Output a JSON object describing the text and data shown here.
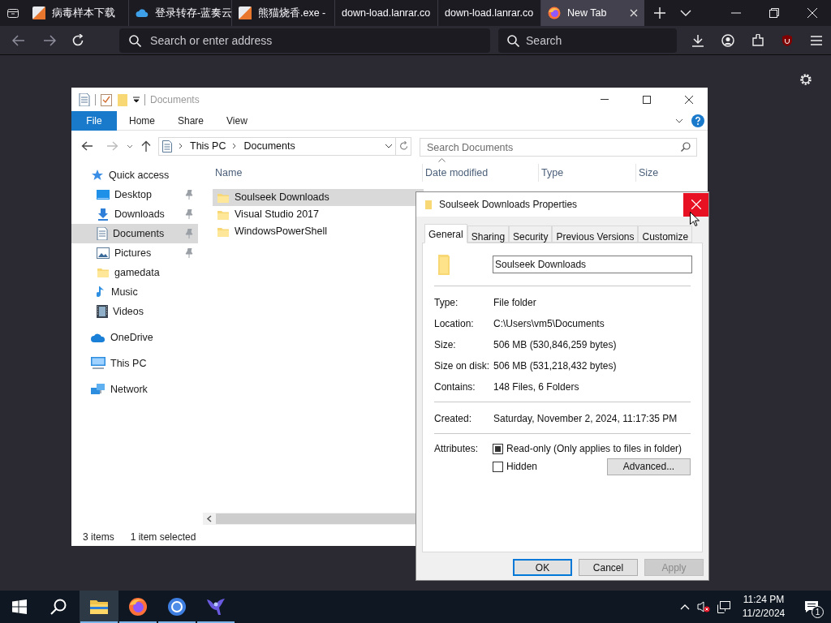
{
  "browser": {
    "tabs": [
      {
        "title": "病毒样本下载",
        "kind": "site",
        "selected": false
      },
      {
        "title": "登录转存-蓝奏云",
        "kind": "cloud",
        "selected": false
      },
      {
        "title": "熊猫烧香.exe -",
        "kind": "site",
        "selected": false
      },
      {
        "title": "down-load.lanrar.co",
        "kind": "plain",
        "selected": false
      },
      {
        "title": "down-load.lanrar.co",
        "kind": "plain",
        "selected": false
      },
      {
        "title": "New Tab",
        "kind": "firefox",
        "selected": true
      }
    ],
    "address": {
      "placeholder": "Search or enter address"
    },
    "search": {
      "placeholder": "Search"
    }
  },
  "explorer": {
    "title": "Documents",
    "ribbon_tabs": [
      {
        "label": "File",
        "selected": true
      },
      {
        "label": "Home",
        "selected": false
      },
      {
        "label": "Share",
        "selected": false
      },
      {
        "label": "View",
        "selected": false
      }
    ],
    "path": [
      "This PC",
      "Documents"
    ],
    "search": {
      "placeholder": "Search Documents"
    },
    "columns": [
      "Name",
      "Date modified",
      "Type",
      "Size"
    ],
    "nav": [
      {
        "label": "Quick access",
        "kind": "star",
        "selected": false,
        "children": [
          {
            "label": "Desktop",
            "kind": "desktop",
            "pinned": true,
            "selected": false
          },
          {
            "label": "Downloads",
            "kind": "download",
            "pinned": true,
            "selected": false
          },
          {
            "label": "Documents",
            "kind": "document",
            "pinned": true,
            "selected": true
          },
          {
            "label": "Pictures",
            "kind": "picture",
            "pinned": true,
            "selected": false
          },
          {
            "label": "gamedata",
            "kind": "folder",
            "pinned": false,
            "selected": false
          },
          {
            "label": "Music",
            "kind": "music",
            "pinned": false,
            "selected": false
          },
          {
            "label": "Videos",
            "kind": "video",
            "pinned": false,
            "selected": false
          }
        ]
      },
      {
        "label": "OneDrive",
        "kind": "cloud",
        "selected": false
      },
      {
        "label": "This PC",
        "kind": "pc",
        "selected": false
      },
      {
        "label": "Network",
        "kind": "network",
        "selected": false
      }
    ],
    "files": [
      {
        "name": "Soulseek Downloads",
        "selected": true
      },
      {
        "name": "Visual Studio 2017",
        "selected": false
      },
      {
        "name": "WindowsPowerShell",
        "selected": false
      }
    ],
    "status": [
      "3 items",
      "1 item selected"
    ]
  },
  "dialog": {
    "title": "Soulseek Downloads Properties",
    "tabs": [
      {
        "label": "General",
        "selected": true
      },
      {
        "label": "Sharing",
        "selected": false
      },
      {
        "label": "Security",
        "selected": false
      },
      {
        "label": "Previous Versions",
        "selected": false
      },
      {
        "label": "Customize",
        "selected": false
      }
    ],
    "name_field": {
      "value": "Soulseek Downloads"
    },
    "groups": [
      [
        {
          "label": "Type:",
          "value": "File folder"
        },
        {
          "label": "Location:",
          "value": "C:\\Users\\vm5\\Documents"
        },
        {
          "label": "Size:",
          "value": "506 MB (530,846,259 bytes)"
        },
        {
          "label": "Size on disk:",
          "value": "506 MB (531,218,432 bytes)"
        },
        {
          "label": "Contains:",
          "value": "148 Files, 6 Folders"
        }
      ],
      [
        {
          "label": "Created:",
          "value": "Saturday, November 2, 2024, 11:17:35 PM"
        }
      ]
    ],
    "attributes": {
      "label": "Attributes:",
      "options": [
        {
          "label": "Read-only (Only applies to files in folder)",
          "checked": false,
          "indeterminate": true
        },
        {
          "label": "Hidden",
          "checked": false,
          "indeterminate": false
        }
      ],
      "advanced_button": "Advanced..."
    },
    "buttons": [
      {
        "label": "OK",
        "default": true,
        "disabled": false
      },
      {
        "label": "Cancel",
        "default": false,
        "disabled": false
      },
      {
        "label": "Apply",
        "default": false,
        "disabled": true
      }
    ]
  },
  "taskbar": {
    "apps": [
      {
        "kind": "explorer",
        "selected": true,
        "running": true
      },
      {
        "kind": "firefox",
        "selected": false,
        "running": true
      },
      {
        "kind": "chrome",
        "selected": false,
        "running": true
      },
      {
        "kind": "bird",
        "selected": false,
        "running": true
      }
    ],
    "clock": {
      "time": "11:24 PM",
      "date": "11/2/2024"
    },
    "notifications": "1"
  }
}
